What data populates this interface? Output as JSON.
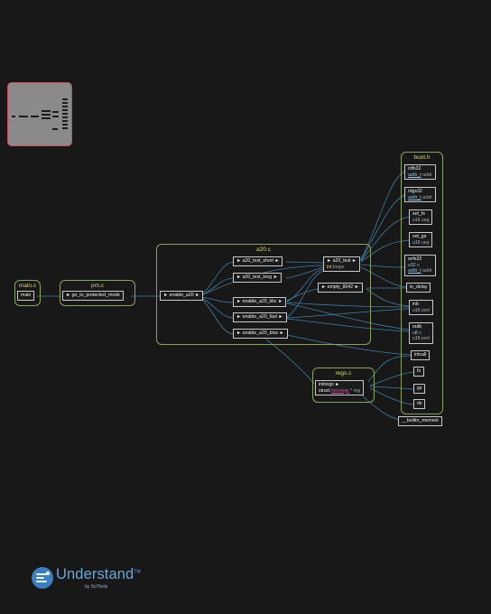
{
  "clusters": {
    "main_c": "main.c",
    "pm_c": "pm.c",
    "a20_c": "a20.c",
    "boot_h": "boot.h",
    "regs_c": "regs.c"
  },
  "nodes": {
    "main": "main",
    "go_to_protected_mode": "► go_to_protected_mode",
    "enable_a20": "► enable_a20 ►",
    "a20_test_short": "► a20_test_short ►",
    "a20_test_long": "► a20_test_long ►",
    "enable_a20_kbc": "► enable_a20_kbc ►",
    "enable_a20_fast": "► enable_a20_fast ►",
    "enable_a20_bios": "► enable_a20_bios ►",
    "a20_test": "► a20_test ►",
    "a20_test_type": "int",
    "a20_test_param": "loops",
    "empty_8042": "► empty_8042 ►",
    "rdfs32": "rdfs32",
    "rdfs32_type": "addr_t",
    "rdfs32_param": "addr",
    "rdgs32": "rdgs32",
    "rdgs32_type": "addr_t",
    "rdgs32_param": "addr",
    "set_fs": "set_fs",
    "set_fs_type": "u16",
    "set_fs_param": "seg",
    "set_gs": "set_gs",
    "set_gs_type": "u16",
    "set_gs_param": "seg",
    "wrfs32": "wrfs32",
    "wrfs32_type1": "u32",
    "wrfs32_param1": "v",
    "wrfs32_type2": "addr_t",
    "wrfs32_param2": "addr",
    "io_delay": "io_delay",
    "inb": "inb",
    "inb_type": "u16",
    "inb_param": "port",
    "outb": "outb",
    "outb_type1": "u8",
    "outb_param1": "v",
    "outb_type2": "u16",
    "outb_param2": "port",
    "intcall": "intcall",
    "initregs": "initregs ►",
    "initregs_kw": "struct",
    "initregs_type": "biosregs",
    "initregs_param": "* reg",
    "fs": "fs",
    "gs": "gs",
    "ds": "ds",
    "builtin_memset": "__builtin_memset"
  },
  "brand": {
    "name": "Understand",
    "trademark": "TM",
    "subtitle": "by SciTools"
  },
  "colors": {
    "background": "#181818",
    "cluster_border": "#8ea35a",
    "cluster_label": "#d9d96b",
    "edge": "#3d7ea8",
    "type_orange": "#e07a44",
    "type_blue": "#8fc5f0",
    "type_pink": "#e054a6",
    "brand_blue": "#68a7dd",
    "minimap_border": "#d04a58"
  }
}
